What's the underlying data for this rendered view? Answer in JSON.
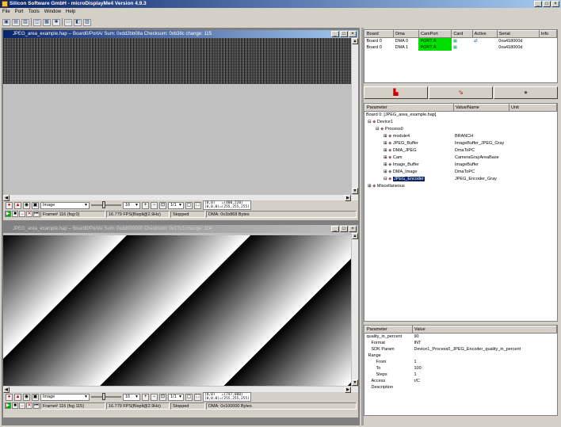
{
  "app": {
    "title": "Silicon Software GmbH - microDisplayMe4 Version 4.9.3"
  },
  "menu": [
    "File",
    "Port",
    "Tools",
    "Window",
    "Help"
  ],
  "window1": {
    "title": "JPEG_area_example.hap -- Board0/PortA/ Sum: 0xdd2bb08a  Checksum: 0xb38c change: 115",
    "image_select": "Image",
    "zoom_value": "16",
    "scale": "1/1",
    "coords": "(0,0)   =(400,220)\n(0,0,0)=(255,255,255)",
    "status": {
      "frame": "Frame# 116 (fsg:0)",
      "fps": "16.779 FPS(Bispli@2.9Hz)",
      "state": "Stopped",
      "dma": "DMA: 0x1b868 Bytes"
    }
  },
  "window2": {
    "title": "JPEG_area_example.hap -- Board0/PortA/ Sum: 0xdd000000  Checksum: 0x17c3 change: 114",
    "image_select": "Image",
    "zoom_value": "16",
    "scale": "1/1",
    "coords": "(0,0)   =(747,000)\n(0,0,0)=(255,255,255)",
    "status": {
      "frame": "Frame# 116 (fsg 115)",
      "fps": "16.779 FPS(Bispli@2.9Hz)",
      "state": "Stopped",
      "dma": "DMA: 0x100000 Bytes"
    }
  },
  "boards": {
    "headers": [
      "Board",
      "Dma",
      "CamPort",
      "Card",
      "Active",
      "Serial",
      "Info"
    ],
    "rows": [
      {
        "board": "Board 0",
        "dma": "DMA 0",
        "port": "PORT A",
        "serial": "0xa418000d"
      },
      {
        "board": "Board 0",
        "dma": "DMA 1",
        "port": "PORT A",
        "serial": "0xa418000d"
      }
    ]
  },
  "param_tree": {
    "headers": [
      "Parameter",
      "Value/Name",
      "Unit"
    ],
    "root": "Board 0: [JPEG_area_example.hap]",
    "nodes": [
      {
        "label": "Device1",
        "value": ""
      },
      {
        "label": "Process0",
        "value": ""
      },
      {
        "label": "module4",
        "value": "BRANCH"
      },
      {
        "label": "JPEG_Buffer",
        "value": "ImageBuffer_JPEG_Gray"
      },
      {
        "label": "DMA_JPEG",
        "value": "DmaToPC"
      },
      {
        "label": "Cam",
        "value": "CameraGrayAreaBase"
      },
      {
        "label": "Image_Buffer",
        "value": "ImageBuffer"
      },
      {
        "label": "DMA_Image",
        "value": "DmaToPC"
      },
      {
        "label": "JPEG_Encoder",
        "value": "JPEG_Encoder_Gray"
      },
      {
        "label": "Miscellaneous",
        "value": ""
      }
    ]
  },
  "properties": {
    "headers": [
      "Parameter",
      "Value"
    ],
    "rows": [
      {
        "name": "quality_in_percent",
        "value": "90"
      },
      {
        "name": "Format",
        "value": "INT"
      },
      {
        "name": "SDK Param",
        "value": "Device1_Process0_JPEG_Encoder_quality_in_percent"
      },
      {
        "name": "Range",
        "value": ""
      },
      {
        "name": "From",
        "value": "1"
      },
      {
        "name": "To",
        "value": "100"
      },
      {
        "name": "Steps",
        "value": "1"
      },
      {
        "name": "Access",
        "value": "r/C"
      },
      {
        "name": "Description",
        "value": ""
      }
    ]
  }
}
